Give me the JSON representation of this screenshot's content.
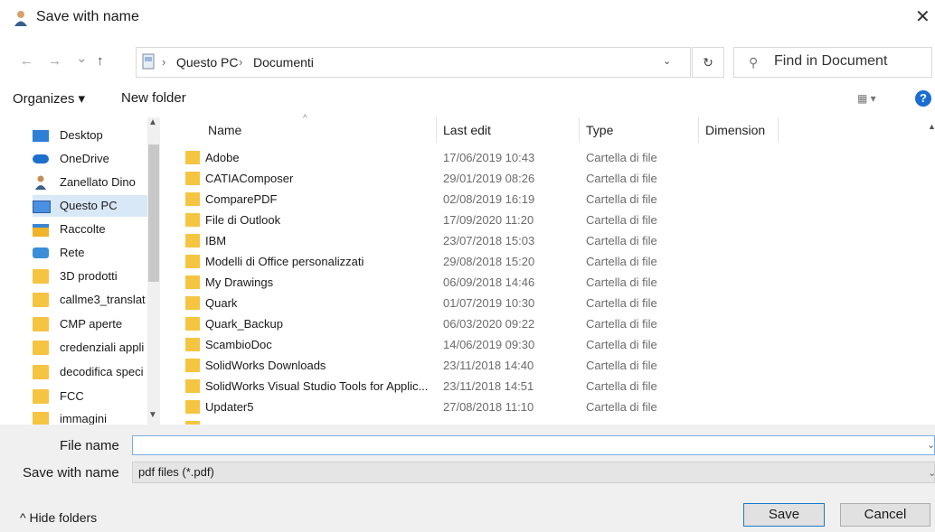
{
  "window": {
    "title": "Save with name",
    "close_glyph": "✕"
  },
  "address": {
    "back": "←",
    "forward": "→",
    "history": "⌄",
    "up": "↑",
    "crumbs": [
      "Questo PC",
      "Documenti"
    ],
    "separator": "›",
    "dropdown": "⌄",
    "refresh": "↻",
    "search_placeholder": "Find in Document"
  },
  "toolbar": {
    "organize": "Organizes ▾",
    "new_folder": "New folder",
    "view": "▦ ▾",
    "help": "?"
  },
  "nav": {
    "items": [
      {
        "label": "Desktop",
        "icon": "desktop-icon"
      },
      {
        "label": "OneDrive",
        "icon": "cloud-icon"
      },
      {
        "label": "Zanellato Dino",
        "icon": "user-icon"
      },
      {
        "label": "Questo PC",
        "icon": "computer-icon",
        "selected": true
      },
      {
        "label": "Raccolte",
        "icon": "library-icon"
      },
      {
        "label": "Rete",
        "icon": "network-icon"
      },
      {
        "label": "3D prodotti",
        "icon": "folder-icon"
      },
      {
        "label": "callme3_translat",
        "icon": "folder-icon"
      },
      {
        "label": "CMP aperte",
        "icon": "folder-icon"
      },
      {
        "label": "credenziali appli",
        "icon": "folder-icon"
      },
      {
        "label": "decodifica speci",
        "icon": "folder-icon"
      },
      {
        "label": "FCC",
        "icon": "folder-icon"
      },
      {
        "label": "immagini",
        "icon": "folder-icon"
      }
    ]
  },
  "columns": {
    "name": "Name",
    "last_edit": "Last edit",
    "type": "Type",
    "dimension": "Dimension"
  },
  "files": [
    {
      "name": "Adobe",
      "date": "17/06/2019 10:43",
      "type": "Cartella di file"
    },
    {
      "name": "CATIAComposer",
      "date": "29/01/2019 08:26",
      "type": "Cartella di file"
    },
    {
      "name": "ComparePDF",
      "date": "02/08/2019 16:19",
      "type": "Cartella di file"
    },
    {
      "name": "File di Outlook",
      "date": "17/09/2020 11:20",
      "type": "Cartella di file"
    },
    {
      "name": "IBM",
      "date": "23/07/2018 15:03",
      "type": "Cartella di file"
    },
    {
      "name": "Modelli di Office personalizzati",
      "date": "29/08/2018 15:20",
      "type": "Cartella di file"
    },
    {
      "name": "My Drawings",
      "date": "06/09/2018 14:46",
      "type": "Cartella di file"
    },
    {
      "name": "Quark",
      "date": "01/07/2019 10:30",
      "type": "Cartella di file"
    },
    {
      "name": "Quark_Backup",
      "date": "06/03/2020 09:22",
      "type": "Cartella di file"
    },
    {
      "name": "ScambioDoc",
      "date": "14/06/2019 09:30",
      "type": "Cartella di file"
    },
    {
      "name": "SolidWorks Downloads",
      "date": "23/11/2018 14:40",
      "type": "Cartella di file"
    },
    {
      "name": "SolidWorks Visual Studio Tools for Applic...",
      "date": "23/11/2018 14:51",
      "type": "Cartella di file"
    },
    {
      "name": "Updater5",
      "date": "27/08/2018 11:10",
      "type": "Cartella di file"
    }
  ],
  "form": {
    "file_name_label": "File name",
    "file_name_value": "",
    "save_type_label": "Save with name",
    "save_type_value": "pdf files (*.pdf)",
    "dropdown": "⌄"
  },
  "footer": {
    "hide_folders": "^  Hide folders",
    "save": "Save",
    "cancel": "Cancel"
  },
  "colors": {
    "folder": "#f5c542",
    "selection": "#d9e8f6",
    "accent": "#1979ca"
  }
}
